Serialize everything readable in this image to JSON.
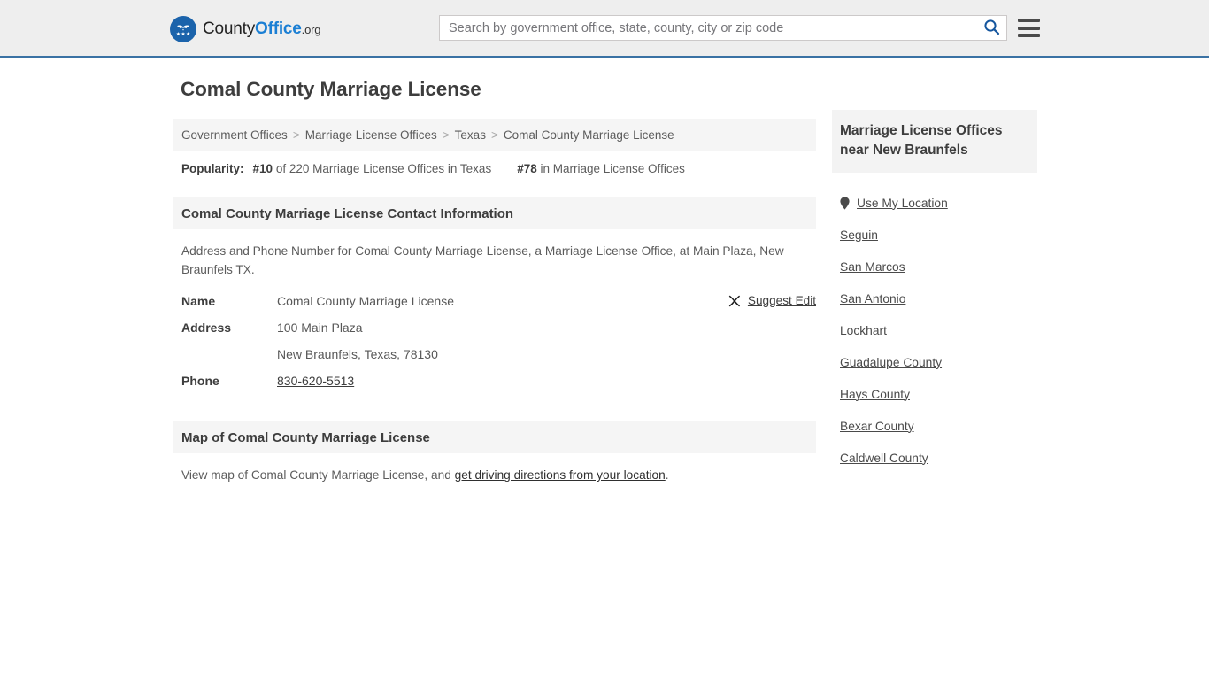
{
  "header": {
    "logo": {
      "part1": "County",
      "part2": "Office",
      "tld": ".org"
    },
    "search": {
      "placeholder": "Search by government office, state, county, city or zip code",
      "value": "",
      "search_icon": "search-icon"
    },
    "menu_icon": "hamburger-menu-icon",
    "accent_color": "#3b72a4",
    "background_color": "#eeeeee"
  },
  "main": {
    "page_title": "Comal County Marriage License",
    "breadcrumb": [
      "Government Offices",
      "Marriage License Offices",
      "Texas",
      "Comal County Marriage License"
    ],
    "breadcrumb_separator": ">",
    "popularity": {
      "label": "Popularity:",
      "state_rank": "#10",
      "state_text": "of 220 Marriage License Offices in Texas",
      "national_rank": "#78",
      "national_text": "in Marriage License Offices"
    },
    "contact_section": {
      "heading": "Comal County Marriage License Contact Information",
      "description": "Address and Phone Number for Comal County Marriage License, a Marriage License Office, at Main Plaza, New Braunfels TX.",
      "rows": [
        {
          "key": "Name",
          "value": "Comal County Marriage License"
        },
        {
          "key": "Address",
          "value": "100 Main Plaza"
        },
        {
          "key": "",
          "value": "New Braunfels, Texas, 78130"
        },
        {
          "key": "Phone",
          "value": "830-620-5513"
        }
      ],
      "suggest_edit": {
        "label": "Suggest Edit",
        "icon": "edit-pencil-icon"
      }
    },
    "map_section": {
      "heading": "Map of Comal County Marriage License",
      "text_before": "View map of Comal County Marriage License, and ",
      "link": "get driving directions from your location",
      "text_after": "."
    }
  },
  "sidebar": {
    "heading": "Marriage License Offices near New Braunfels",
    "use_my_location": {
      "label": "Use My Location",
      "icon": "map-pin-icon"
    },
    "items": [
      {
        "label": "Seguin"
      },
      {
        "label": "San Marcos"
      },
      {
        "label": "San Antonio"
      },
      {
        "label": "Lockhart"
      },
      {
        "label": "Guadalupe County"
      },
      {
        "label": "Hays County"
      },
      {
        "label": "Bexar County"
      },
      {
        "label": "Caldwell County"
      }
    ]
  }
}
